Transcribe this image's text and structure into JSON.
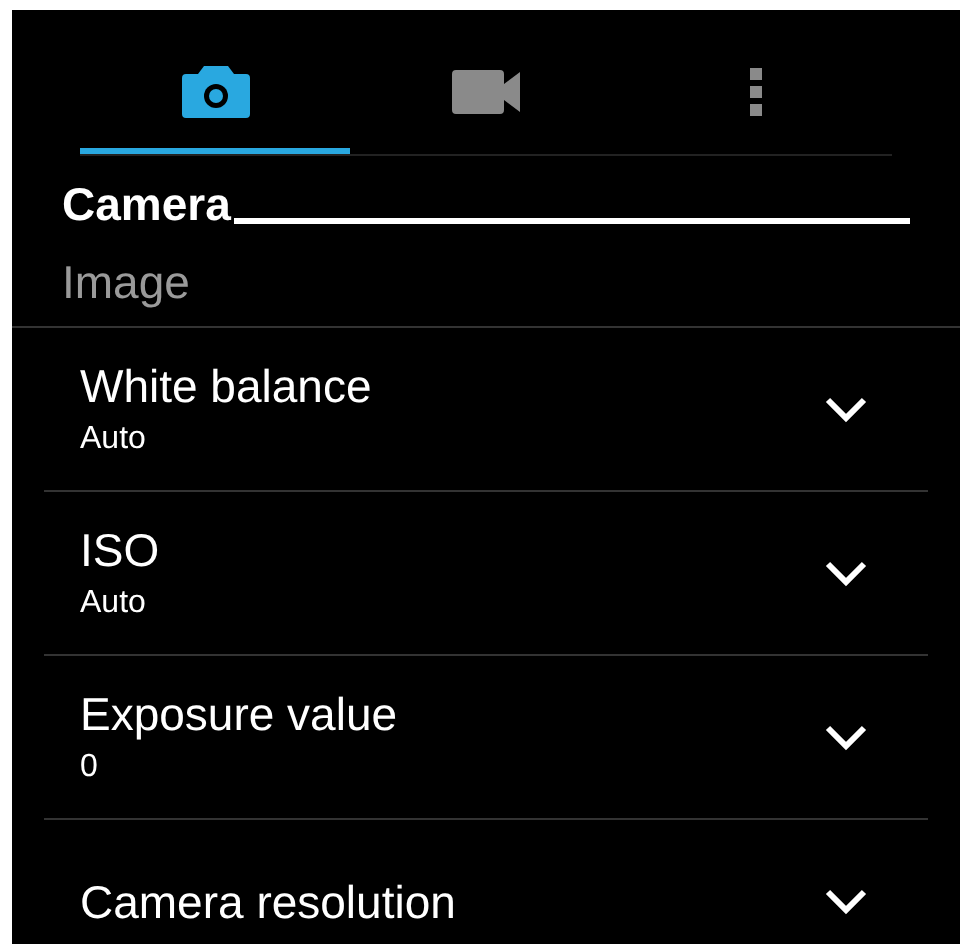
{
  "tabs": [
    {
      "kind": "camera",
      "selected": true
    },
    {
      "kind": "video",
      "selected": false
    },
    {
      "kind": "more",
      "selected": false
    }
  ],
  "section": {
    "title": "Camera"
  },
  "group": {
    "title": "Image"
  },
  "settings": [
    {
      "label": "White balance",
      "value": "Auto"
    },
    {
      "label": "ISO",
      "value": "Auto"
    },
    {
      "label": "Exposure value",
      "value": "0"
    },
    {
      "label": "Camera resolution"
    }
  ]
}
